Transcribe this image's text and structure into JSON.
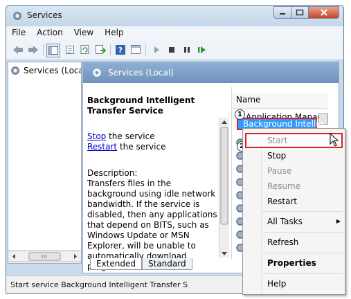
{
  "window": {
    "title": "Services"
  },
  "menu": [
    "File",
    "Action",
    "View",
    "Help"
  ],
  "toolbar": {
    "icons": [
      "back-icon",
      "forward-icon",
      "show-console-tree-icon",
      "properties-icon",
      "refresh-icon",
      "export-list-icon",
      "help-icon",
      "view-icon",
      "start-icon",
      "stop-icon",
      "pause-icon",
      "restart-icon"
    ]
  },
  "tree": {
    "item": "Services (Local)"
  },
  "pane": {
    "header": "Services (Local)"
  },
  "details": {
    "service_name": "Background Intelligent Transfer Service",
    "stop_link": "Stop",
    "stop_suffix": " the service",
    "restart_link": "Restart",
    "restart_suffix": " the service",
    "description_label": "Description:",
    "description": "Transfers files in the background using idle network bandwidth. If the service is disabled, then any applications that depend on BITS, such as Windows Update or MSN Explorer, will be unable to automatically download programs"
  },
  "list": {
    "column_name": "Name",
    "rows": [
      "Application Manage",
      "Background Intellig"
    ]
  },
  "tabs": [
    "Extended",
    "Standard"
  ],
  "status": "Start service Background Intelligent Transfer S",
  "context_menu": {
    "start": "Start",
    "stop": "Stop",
    "pause": "Pause",
    "resume": "Resume",
    "restart": "Restart",
    "all_tasks": "All Tasks",
    "refresh": "Refresh",
    "properties": "Properties",
    "help": "Help"
  },
  "steps": [
    "1",
    "2"
  ],
  "colors": {
    "highlight": "#3399ff",
    "annotation": "#e02020",
    "header": "#7a9cc4"
  }
}
